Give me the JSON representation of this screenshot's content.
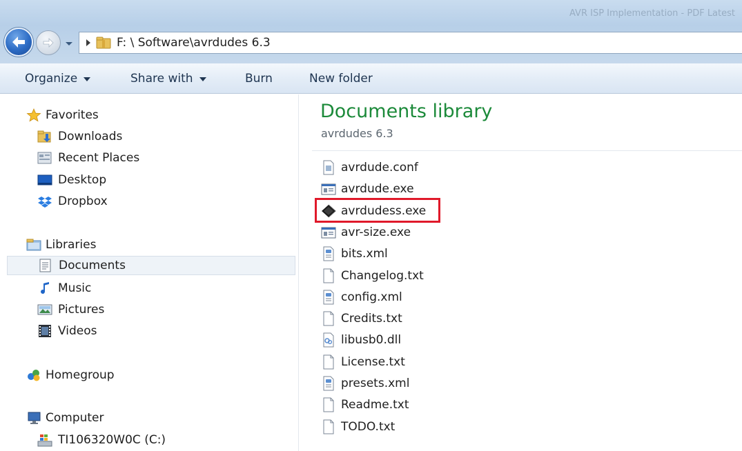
{
  "window": {
    "title": "AVR ISP Implementation - PDF Latest"
  },
  "address_bar": {
    "path": "F: \\ Software\\avrdudes 6.3"
  },
  "toolbar": {
    "organize": "Organize",
    "share_with": "Share with",
    "burn": "Burn",
    "new_folder": "New folder"
  },
  "nav": {
    "favorites": "Favorites",
    "downloads": "Downloads",
    "recent_places": "Recent Places",
    "desktop": "Desktop",
    "dropbox": "Dropbox",
    "libraries": "Libraries",
    "documents": "Documents",
    "music": "Music",
    "pictures": "Pictures",
    "videos": "Videos",
    "homegroup": "Homegroup",
    "computer": "Computer",
    "drive_c": "TI106320W0C (C:)"
  },
  "library": {
    "title": "Documents library",
    "subtitle": "avrdudes 6.3"
  },
  "files": [
    {
      "name": "avrdude.conf",
      "icon": "conf-file-icon"
    },
    {
      "name": "avrdude.exe",
      "icon": "exe-window-icon"
    },
    {
      "name": "avrdudess.exe",
      "icon": "chip-app-icon"
    },
    {
      "name": "avr-size.exe",
      "icon": "exe-window-icon"
    },
    {
      "name": "bits.xml",
      "icon": "xml-file-icon"
    },
    {
      "name": "Changelog.txt",
      "icon": "text-file-icon"
    },
    {
      "name": "config.xml",
      "icon": "xml-file-icon"
    },
    {
      "name": "Credits.txt",
      "icon": "text-file-icon"
    },
    {
      "name": "libusb0.dll",
      "icon": "dll-file-icon"
    },
    {
      "name": "License.txt",
      "icon": "text-file-icon"
    },
    {
      "name": "presets.xml",
      "icon": "xml-file-icon"
    },
    {
      "name": "Readme.txt",
      "icon": "text-file-icon"
    },
    {
      "name": "TODO.txt",
      "icon": "text-file-icon"
    }
  ],
  "highlighted_file": "avrdudess.exe",
  "colors": {
    "highlight": "#e0192a",
    "library_title": "#1c8a3a"
  }
}
